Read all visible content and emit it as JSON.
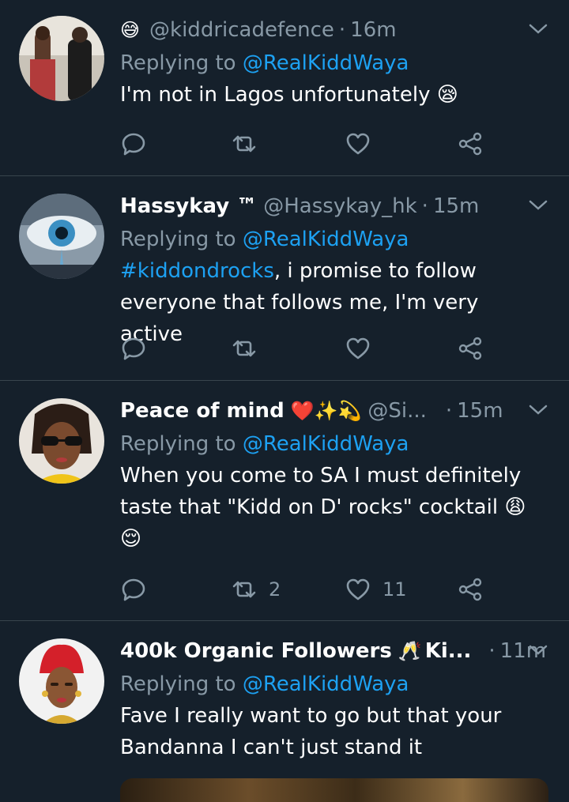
{
  "tweets": [
    {
      "name": "",
      "name_emoji": "😅",
      "handle": "@kiddricadefence",
      "time": "16m",
      "replying_prefix": "Replying to",
      "replying_to": "@RealKiddWaya",
      "text": "I'm not in Lagos unfortunately 😪",
      "retweets": "",
      "likes": ""
    },
    {
      "name": "Hassykay ™",
      "name_emoji": "",
      "handle": "@Hassykay_hk",
      "time": "15m",
      "replying_prefix": "Replying to",
      "replying_to": "@RealKiddWaya",
      "hashtag": "#kiddondrocks",
      "text": ", i promise to follow everyone that follows me, I'm very active",
      "retweets": "",
      "likes": ""
    },
    {
      "name": "Peace of mind",
      "name_emoji": "❤️✨💫",
      "handle": "@Si...",
      "time": "15m",
      "replying_prefix": "Replying to",
      "replying_to": "@RealKiddWaya",
      "text": "When you come to SA I must definitely taste that \"Kidd on D' rocks\" cocktail 😩 😌",
      "retweets": "2",
      "likes": "11"
    },
    {
      "name": "400k Organic Followers",
      "name_emoji": "🥂",
      "name_suffix": "Ki...",
      "handle": "",
      "time": "11m",
      "replying_prefix": "Replying to",
      "replying_to": "@RealKiddWaya",
      "text": "Fave I really want to go but that your Bandanna I can't just stand it",
      "retweets": "",
      "likes": ""
    }
  ],
  "colors": {
    "background": "#15202b",
    "secondary_text": "#8899a6",
    "link": "#1da1f2",
    "divider": "#38444d"
  },
  "icons": [
    "reply-icon",
    "retweet-icon",
    "like-icon",
    "share-icon",
    "chevron-down-icon"
  ]
}
